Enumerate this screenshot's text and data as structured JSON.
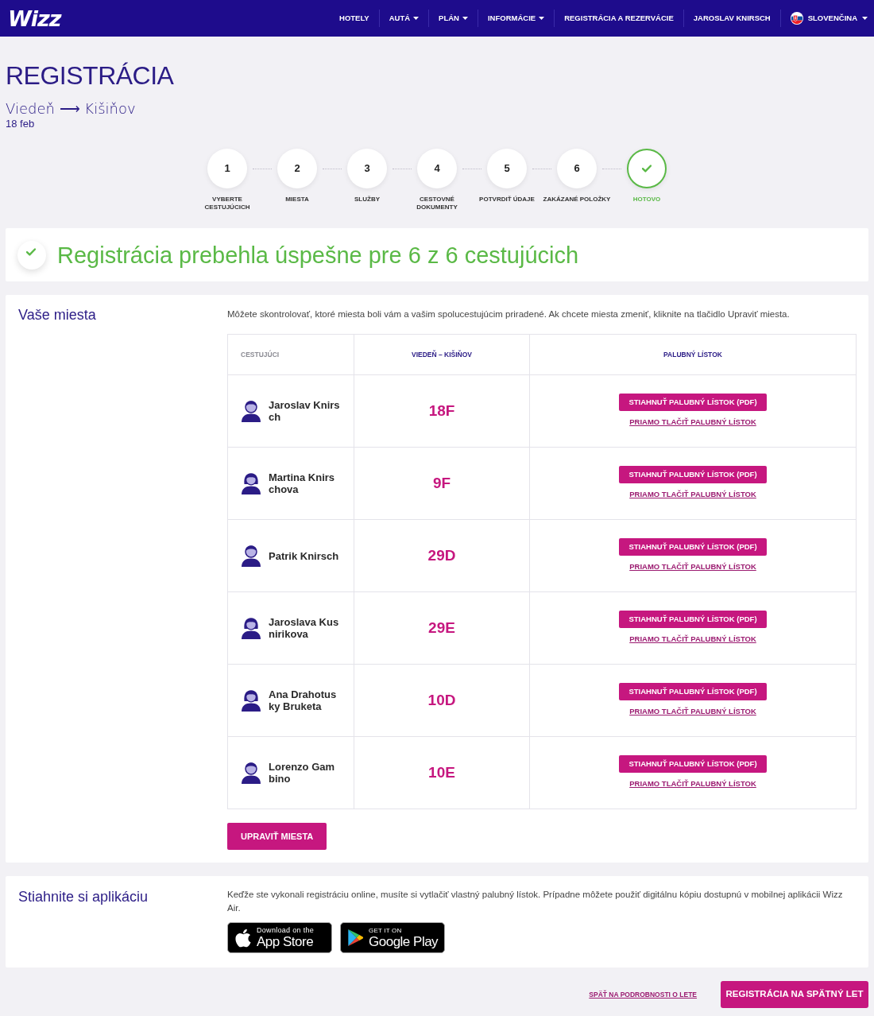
{
  "header": {
    "logo": "Wizz",
    "nav": [
      {
        "label": "HOTELY",
        "dropdown": false
      },
      {
        "label": "AUTÁ",
        "dropdown": true
      },
      {
        "label": "PLÁN",
        "dropdown": true
      },
      {
        "label": "INFORMÁCIE",
        "dropdown": true
      },
      {
        "label": "REGISTRÁCIA A REZERVÁCIE",
        "dropdown": false
      },
      {
        "label": "JAROSLAV KNIRSCH",
        "dropdown": false
      }
    ],
    "language": {
      "label": "SLOVENČINA",
      "dropdown": true
    }
  },
  "title": "REGISTRÁCIA",
  "route": "Viedeň ⟶ Kišiňov",
  "date": "18 feb",
  "steps": [
    {
      "number": "1",
      "label": "VYBERTE CESTUJÚCICH",
      "current": false
    },
    {
      "number": "2",
      "label": "MIESTA",
      "current": false
    },
    {
      "number": "3",
      "label": "SLUŽBY",
      "current": false
    },
    {
      "number": "4",
      "label": "CESTOVNÉ DOKUMENTY",
      "current": false
    },
    {
      "number": "5",
      "label": "POTVRDIŤ ÚDAJE",
      "current": false
    },
    {
      "number": "6",
      "label": "ZAKÁZANÉ POLOŽKY",
      "current": false
    },
    {
      "label": "HOTOVO",
      "current": true
    }
  ],
  "success": {
    "message": "Registrácia prebehla úspešne pre 6 z 6 cestujúcich"
  },
  "seats": {
    "heading": "Vaše miesta",
    "description": "Môžete skontrolovať, ktoré miesta boli vám a vašim spolucestujúcim priradené. Ak chcete miesta zmeniť, kliknite na tlačidlo Upraviť miesta.",
    "table": {
      "columns": [
        "CESTUJÚCI",
        "VIEDEŇ – KIŠIŇOV",
        "PALUBNÝ LÍSTOK"
      ],
      "rows": [
        {
          "kind": "male",
          "passenger": "Jaroslav Knirsch",
          "seat": "18F",
          "download": "STIAHNUŤ PALUBNÝ LÍSTOK (PDF)",
          "print": "PRIAMO TLAČIŤ PALUBNÝ LÍSTOK"
        },
        {
          "kind": "female",
          "passenger": "Martina Knirschova",
          "seat": "9F",
          "download": "STIAHNUŤ PALUBNÝ LÍSTOK (PDF)",
          "print": "PRIAMO TLAČIŤ PALUBNÝ LÍSTOK"
        },
        {
          "kind": "male",
          "passenger": "Patrik Knirsch",
          "seat": "29D",
          "download": "STIAHNUŤ PALUBNÝ LÍSTOK (PDF)",
          "print": "PRIAMO TLAČIŤ PALUBNÝ LÍSTOK"
        },
        {
          "kind": "female",
          "passenger": "Jaroslava Kusnirikova",
          "seat": "29E",
          "download": "STIAHNUŤ PALUBNÝ LÍSTOK (PDF)",
          "print": "PRIAMO TLAČIŤ PALUBNÝ LÍSTOK"
        },
        {
          "kind": "female",
          "passenger": "Ana Drahotusky Bruketa",
          "seat": "10D",
          "download": "STIAHNUŤ PALUBNÝ LÍSTOK (PDF)",
          "print": "PRIAMO TLAČIŤ PALUBNÝ LÍSTOK"
        },
        {
          "kind": "male",
          "passenger": "Lorenzo Gambino",
          "seat": "10E",
          "download": "STIAHNUŤ PALUBNÝ LÍSTOK (PDF)",
          "print": "PRIAMO TLAČIŤ PALUBNÝ LÍSTOK"
        }
      ]
    },
    "edit_button": "UPRAVIŤ MIESTA"
  },
  "app": {
    "heading": "Stiahnite si aplikáciu",
    "text": "Keďže ste vykonali registráciu online, musíte si vytlačiť vlastný palubný lístok. Prípadne môžete použiť digitálnu kópiu dostupnú v mobilnej aplikácii Wizz Air.",
    "badges": [
      {
        "kind": "apple",
        "small": "Download on the",
        "big": "App Store"
      },
      {
        "kind": "google",
        "small": "GET IT ON",
        "big": "Google Play"
      }
    ]
  },
  "footer": {
    "back_link": "SPÄŤ NA PODROBNOSTI O LETE",
    "next_button": "REGISTRÁCIA NA SPÄTNÝ LET"
  }
}
